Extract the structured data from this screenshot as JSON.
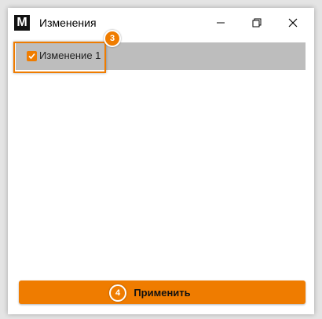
{
  "window": {
    "logo_letter": "M",
    "title": "Изменения",
    "controls": {
      "minimize_icon": "minimize-icon",
      "maximize_icon": "restore-icon",
      "close_icon": "close-icon"
    }
  },
  "changes_list": {
    "items": [
      {
        "label": "Изменение 1",
        "checked": true
      }
    ]
  },
  "annotations": {
    "step_list": "3",
    "step_apply": "4"
  },
  "footer": {
    "apply_label": "Применить"
  },
  "colors": {
    "accent": "#ef7c00",
    "selected_row": "#bdbdbd",
    "logo_bg": "#111111"
  }
}
